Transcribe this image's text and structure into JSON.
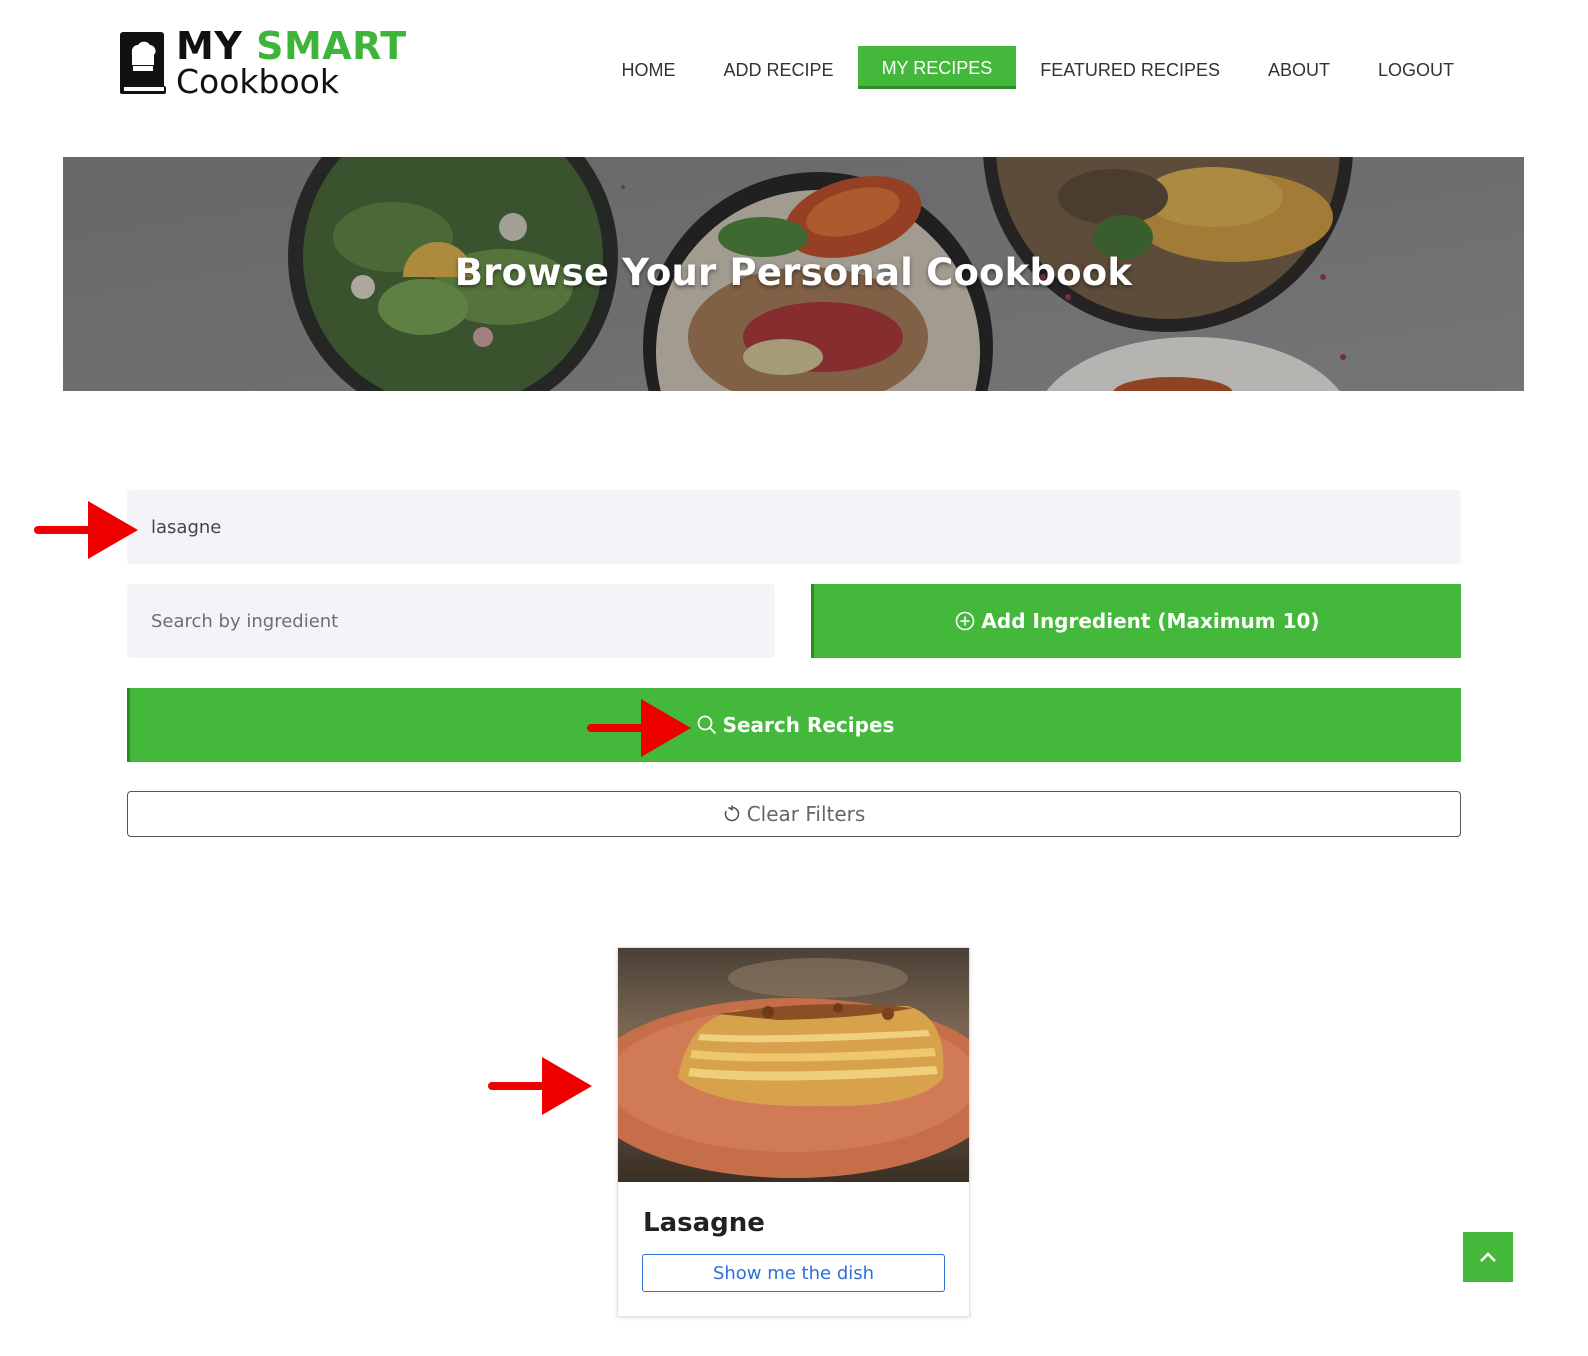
{
  "brand": {
    "line1_a": "MY",
    "line1_b": "SMART",
    "line2": "Cookbook"
  },
  "nav": {
    "items": [
      {
        "label": "HOME",
        "active": false
      },
      {
        "label": "ADD RECIPE",
        "active": false
      },
      {
        "label": "MY RECIPES",
        "active": true
      },
      {
        "label": "FEATURED RECIPES",
        "active": false
      },
      {
        "label": "ABOUT",
        "active": false
      },
      {
        "label": "LOGOUT",
        "active": false
      }
    ]
  },
  "hero": {
    "title": "Browse Your Personal Cookbook"
  },
  "search": {
    "name_value": "lasagne",
    "ingredient_placeholder": "Search by ingredient",
    "add_ingredient_label": "Add Ingredient (Maximum 10)",
    "search_label": "Search Recipes",
    "clear_label": "Clear Filters"
  },
  "results": [
    {
      "title": "Lasagne",
      "button_label": "Show me the dish",
      "image": "lasagne-photo"
    }
  ],
  "icons": {
    "logo": "chef-hat-book-icon",
    "add": "plus-circle-icon",
    "search": "search-icon",
    "clear": "refresh-icon",
    "back_to_top": "chevron-up-icon"
  },
  "colors": {
    "accent": "#43b83b",
    "link": "#2d6fd6",
    "annotation": "#ee0000"
  }
}
